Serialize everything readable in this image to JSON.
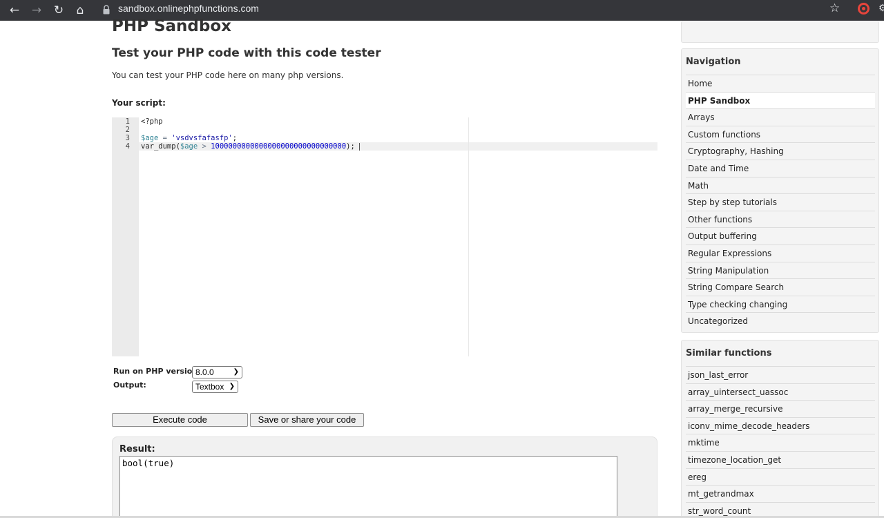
{
  "browser": {
    "url": "sandbox.onlinephpfunctions.com"
  },
  "page": {
    "title": "PHP Sandbox",
    "subtitle": "Test your PHP code with this code tester",
    "intro": "You can test your PHP code here on many php versions.",
    "script_label": "Your script:"
  },
  "editor": {
    "line_numbers": [
      "1",
      "2",
      "3",
      "4"
    ],
    "lines": {
      "l1": "<?php",
      "l3_var": "$age",
      "l3_op": " = ",
      "l3_str": "'vsdvsfafasfp'",
      "l3_end": ";",
      "l4_fn": "var_dump(",
      "l4_var": "$age",
      "l4_op": " > ",
      "l4_num": "1000000000000000000000000000000",
      "l4_end": ");"
    }
  },
  "form": {
    "php_version_label": "Run on PHP version:",
    "php_version_value": "8.0.0",
    "output_label": "Output:",
    "output_value": "Textbox",
    "execute_label": "Execute code",
    "save_label": "Save or share your code"
  },
  "result": {
    "label": "Result:",
    "value": "bool(true)"
  },
  "navigation": {
    "title": "Navigation",
    "items": [
      "Home",
      "PHP Sandbox",
      "Arrays",
      "Custom functions",
      "Cryptography, Hashing",
      "Date and Time",
      "Math",
      "Step by step tutorials",
      "Other functions",
      "Output buffering",
      "Regular Expressions",
      "String Manipulation",
      "String Compare Search",
      "Type checking changing",
      "Uncategorized"
    ],
    "active": "PHP Sandbox"
  },
  "similar": {
    "title": "Similar functions",
    "items": [
      "json_last_error",
      "array_uintersect_uassoc",
      "array_merge_recursive",
      "iconv_mime_decode_headers",
      "mktime",
      "timezone_location_get",
      "ereg",
      "mt_getrandmax",
      "str_word_count"
    ]
  },
  "colors": {
    "chrome": "#35363a",
    "panel": "#f4f4f4",
    "gutter": "#ebebeb"
  }
}
